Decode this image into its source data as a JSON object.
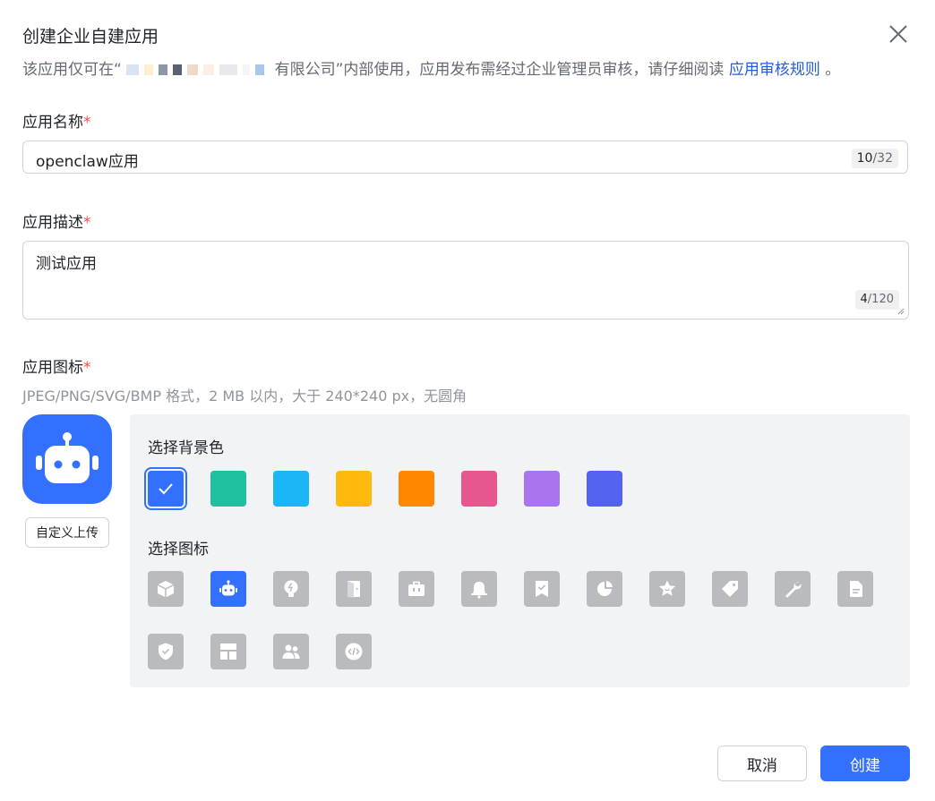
{
  "dialog": {
    "title": "创建企业自建应用",
    "notice_prefix": "该应用仅可在“",
    "notice_suffix": "有限公司”内部使用，应用发布需经过企业管理员审核，请仔细阅读",
    "notice_link": "应用审核规则",
    "notice_end": " 。"
  },
  "name_field": {
    "label": "应用名称",
    "required_mark": "*",
    "value": "openclaw应用",
    "count": "10",
    "max": "/32"
  },
  "desc_field": {
    "label": "应用描述",
    "required_mark": "*",
    "value": "测试应用",
    "count": "4",
    "max": "/120"
  },
  "icon_field": {
    "label": "应用图标",
    "required_mark": "*",
    "hint": "JPEG/PNG/SVG/BMP 格式，2 MB 以内，大于 240*240 px，无圆角",
    "upload_label": "自定义上传",
    "bg_title": "选择背景色",
    "icon_title": "选择图标",
    "bg_colors": [
      "#3370ff",
      "#1ec0a0",
      "#1ab6f5",
      "#ffba0d",
      "#ff8800",
      "#e8568f",
      "#a875ee",
      "#5463ef"
    ],
    "selected_bg": 0,
    "icons": [
      "cube-icon",
      "robot-icon",
      "lightbulb-icon",
      "door-icon",
      "briefcase-icon",
      "bell-icon",
      "bookmark-check-icon",
      "pie-chart-icon",
      "star-face-icon",
      "tag-icon",
      "wrench-icon",
      "document-icon",
      "shield-check-icon",
      "layout-icon",
      "users-icon",
      "code-icon"
    ],
    "selected_icon": 1
  },
  "actions": {
    "cancel": "取消",
    "create": "创建"
  },
  "colors": {
    "primary": "#3370ff",
    "icon_bg": "#b9bbbf",
    "panel_bg": "#f2f3f5",
    "required": "#f54a45"
  }
}
